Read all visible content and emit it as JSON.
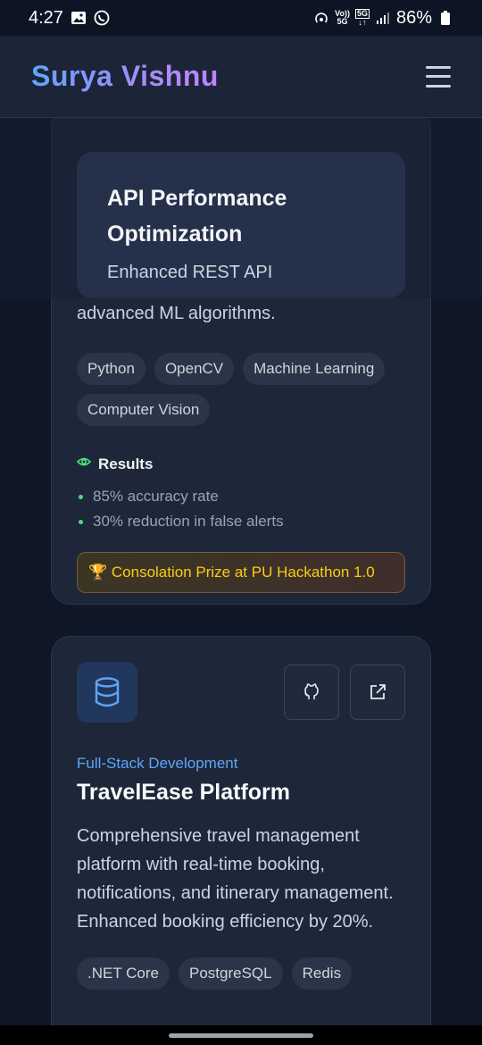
{
  "status_bar": {
    "time": "4:27",
    "battery": "86%",
    "net_top": "Vo))",
    "net_bottom": "5G",
    "sig_top": "5G",
    "sig_bottom": "↓↑"
  },
  "header": {
    "brand": "Surya Vishnu"
  },
  "overlay_card": {
    "title": "API Performance Optimization",
    "description": "Enhanced REST API"
  },
  "project1": {
    "description_tail": "advanced ML algorithms.",
    "tags": [
      "Python",
      "OpenCV",
      "Machine Learning",
      "Computer Vision"
    ],
    "results_label": "Results",
    "results": [
      "85% accuracy rate",
      "30% reduction in false alerts"
    ],
    "prize": "🏆 Consolation Prize at PU Hackathon 1.0"
  },
  "project2": {
    "category": "Full-Stack Development",
    "title": "TravelEase Platform",
    "description": "Comprehensive travel management platform with real-time booking, notifications, and itinerary management. Enhanced booking efficiency by 20%.",
    "tags": [
      ".NET Core",
      "PostgreSQL",
      "Redis"
    ]
  },
  "colors": {
    "accent_blue": "#60a5fa",
    "accent_purple": "#a78bfa",
    "success_green": "#4ade80",
    "prize_yellow": "#facc15"
  }
}
